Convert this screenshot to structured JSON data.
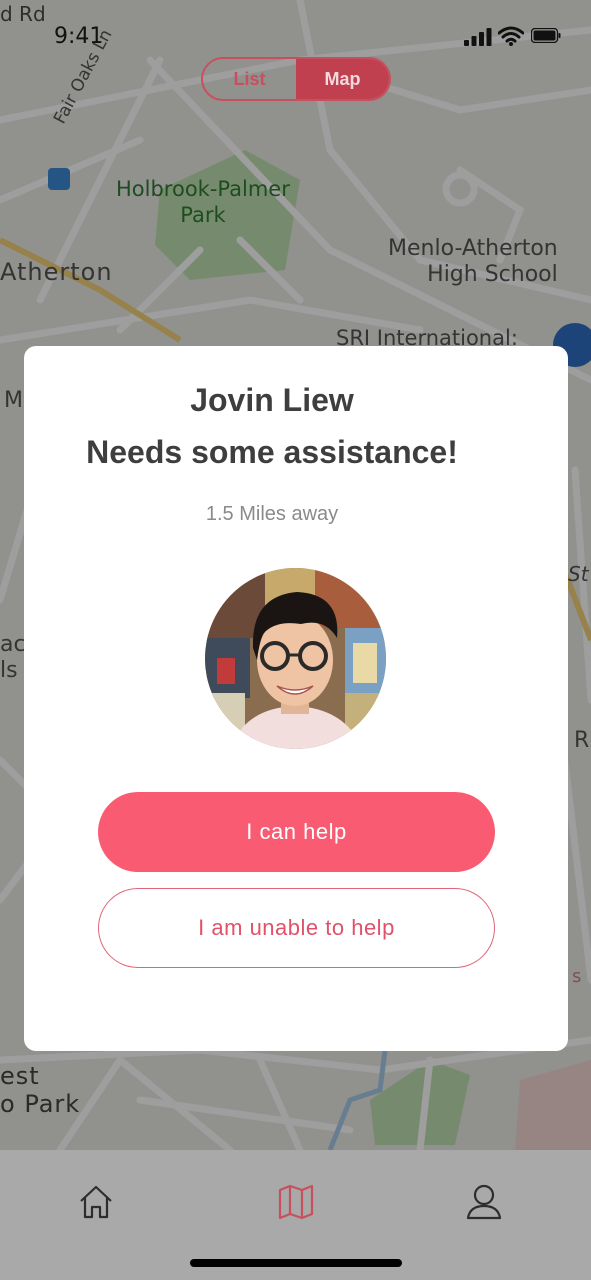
{
  "status_bar": {
    "time": "9:41"
  },
  "view_toggle": {
    "options": [
      "List",
      "Map"
    ],
    "selected": "Map"
  },
  "map": {
    "labels": {
      "road_top": "d Rd",
      "fair_oaks": "Fair Oaks Ln",
      "park": "Holbrook-Palmer\nPark",
      "atherton": "Atherton",
      "school": "Menlo-Atherton\nHigh School",
      "sri": "SRI International:",
      "left_m": "M",
      "left_ac": "ac",
      "left_ls": "ls",
      "right_st": "St",
      "right_r": "R",
      "right_s": "s",
      "bottom_park": "est\no Park"
    }
  },
  "request_modal": {
    "name": "Jovin Liew",
    "message": "Needs some assistance!",
    "distance": "1.5 Miles away",
    "accept_label": "I can help",
    "decline_label": "I am unable to help"
  },
  "tab_bar": {
    "items": [
      {
        "icon": "home-icon",
        "active": false
      },
      {
        "icon": "map-icon",
        "active": true
      },
      {
        "icon": "profile-icon",
        "active": false
      }
    ],
    "active_color": "#c8505e"
  },
  "colors": {
    "accent": "#f95c72",
    "accent_outline": "#e06677"
  }
}
